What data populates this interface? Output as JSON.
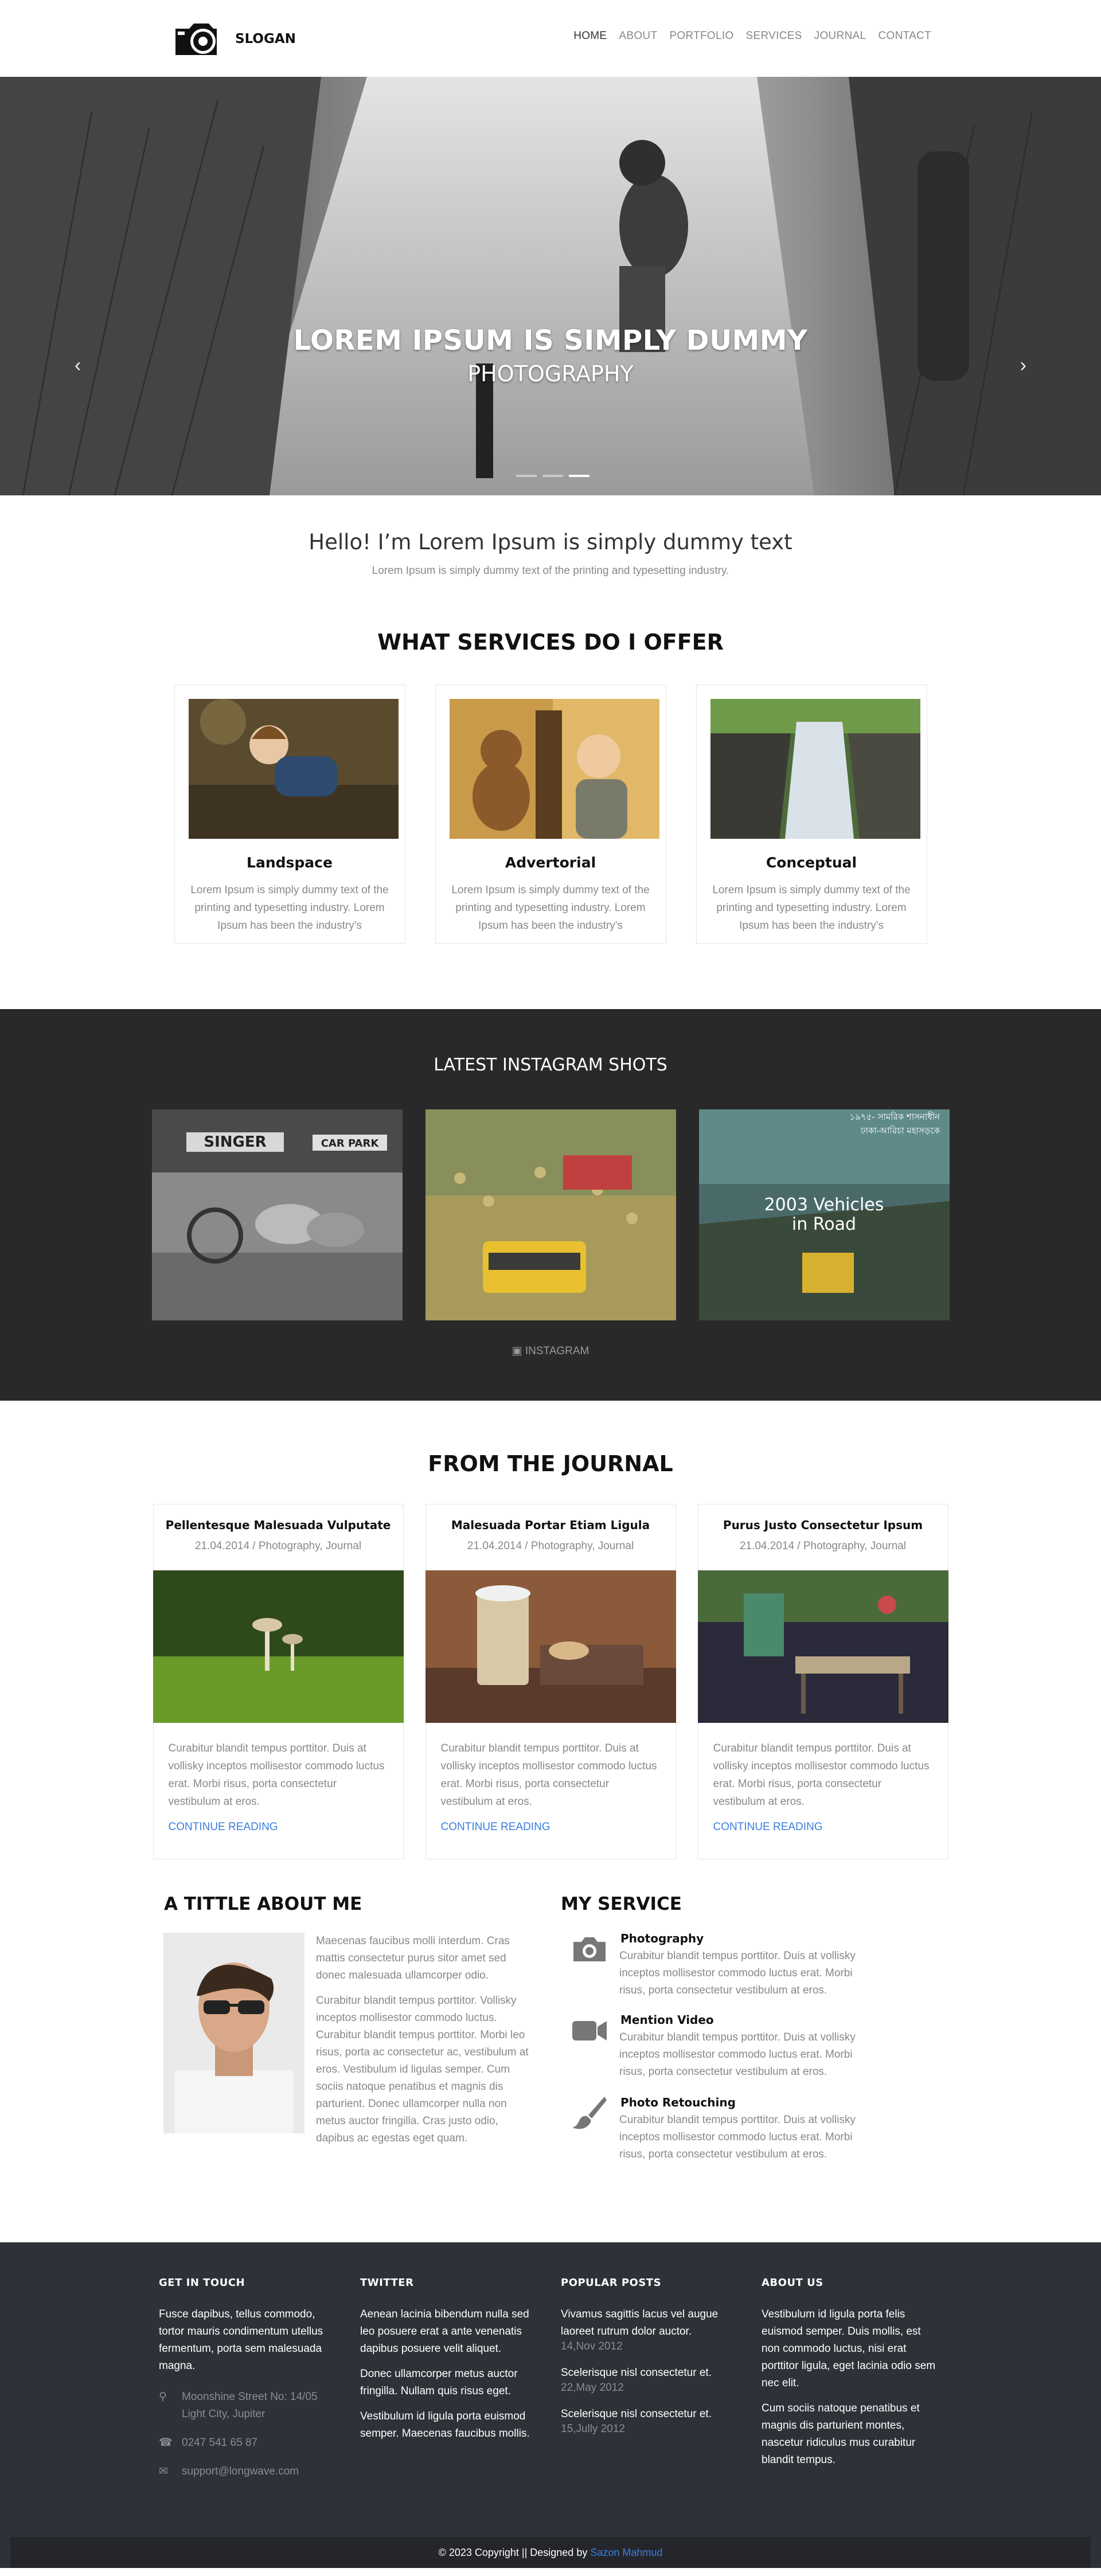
{
  "header": {
    "logo_text": "SLOGAN",
    "nav": [
      "HOME",
      "ABOUT",
      "PORTFOLIO",
      "SERVICES",
      "JOURNAL",
      "CONTACT"
    ],
    "active_nav": "HOME"
  },
  "hero": {
    "title": "LOREM IPSUM IS SIMPLY DUMMY",
    "subtitle": "PHOTOGRAPHY",
    "prev_icon": "chevron-left-icon",
    "next_icon": "chevron-right-icon",
    "slide_count": 3,
    "active_slide": 3
  },
  "intro": {
    "heading": "Hello! I’m Lorem Ipsum is simply dummy text",
    "text": "Lorem Ipsum is simply dummy text of the printing and typesetting industry."
  },
  "services": {
    "title": "WHAT SERVICES DO I OFFER",
    "items": [
      {
        "title": "Landspace",
        "text": "Lorem Ipsum is simply dummy text of the printing and typesetting industry. Lorem Ipsum has been the industry's"
      },
      {
        "title": "Advertorial",
        "text": "Lorem Ipsum is simply dummy text of the printing and typesetting industry. Lorem Ipsum has been the industry's"
      },
      {
        "title": "Conceptual",
        "text": "Lorem Ipsum is simply dummy text of the printing and typesetting industry. Lorem Ipsum has been the industry's"
      }
    ]
  },
  "instagram": {
    "title": "LATEST INSTAGRAM SHOTS",
    "photo_captions": [
      "2003 Vehicles",
      "in Road"
    ],
    "photo_text": [
      "SINGER",
      "CAR PARK",
      "১৯৭৫- সামরিক শাসনাধীন",
      "ঢাকা-আরিচা মহাসড়কে"
    ],
    "link_icon": "instagram-icon",
    "link_label": "INSTAGRAM"
  },
  "journal": {
    "title": "FROM THE JOURNAL",
    "posts": [
      {
        "title": "Pellentesque Malesuada Vulputate",
        "meta": "21.04.2014 / Photography, Journal",
        "excerpt": "Curabitur blandit tempus porttitor. Duis at vollisky inceptos mollisestor commodo luctus erat. Morbi risus, porta consectetur vestibulum at eros.",
        "link": "CONTINUE READING"
      },
      {
        "title": "Malesuada Portar Etiam Ligula",
        "meta": "21.04.2014 / Photography, Journal",
        "excerpt": "Curabitur blandit tempus porttitor. Duis at vollisky inceptos mollisestor commodo luctus erat. Morbi risus, porta consectetur vestibulum at eros.",
        "link": "CONTINUE READING"
      },
      {
        "title": "Purus Justo Consectetur Ipsum",
        "meta": "21.04.2014 / Photography, Journal",
        "excerpt": "Curabitur blandit tempus porttitor. Duis at vollisky inceptos mollisestor commodo luctus erat. Morbi risus, porta consectetur vestibulum at eros.",
        "link": "CONTINUE READING"
      }
    ]
  },
  "about": {
    "title": "A TITTLE ABOUT ME",
    "para1": "Maecenas faucibus molli interdum. Cras mattis consectetur purus sitor amet sed donec malesuada ullamcorper odio.",
    "para2": "Curabitur blandit tempus porttitor. Vollisky inceptos mollisestor commodo luctus. Curabitur blandit tempus porttitor. Morbi leo risus, porta ac consectetur ac, vestibulum at eros. Vestibulum id ligulas semper. Cum sociis natoque penatibus et magnis dis parturient. Donec ullamcorper nulla non metus auctor fringilla. Cras justo odio, dapibus ac egestas eget quam."
  },
  "my_service": {
    "title": "MY SERVICE",
    "items": [
      {
        "icon": "camera-icon",
        "title": "Photography",
        "text": "Curabitur blandit tempus porttitor. Duis at vollisky inceptos mollisestor commodo luctus erat. Morbi risus, porta consectetur vestibulum at eros."
      },
      {
        "icon": "video-camera-icon",
        "title": "Mention Video",
        "text": "Curabitur blandit tempus porttitor. Duis at vollisky inceptos mollisestor commodo luctus erat. Morbi risus, porta consectetur vestibulum at eros."
      },
      {
        "icon": "paint-brush-icon",
        "title": "Photo Retouching",
        "text": "Curabitur blandit tempus porttitor. Duis at vollisky inceptos mollisestor commodo luctus erat. Morbi risus, porta consectetur vestibulum at eros."
      }
    ]
  },
  "footer": {
    "contact": {
      "title": "GET IN TOUCH",
      "text": "Fusce dapibus, tellus commodo, tortor mauris condimentum utellus fermentum, porta sem malesuada magna.",
      "address": "Moonshine Street No: 14/05 Light City, Jupiter",
      "phone": "0247 541 65 87",
      "email": "support@longwave.com"
    },
    "twitter": {
      "title": "TWITTER",
      "tweets": [
        "Aenean lacinia bibendum nulla sed leo posuere erat a ante venenatis dapibus posuere velit aliquet.",
        "Donec ullamcorper metus auctor fringilla. Nullam quis risus eget.",
        "Vestibulum id ligula porta euismod semper. Maecenas faucibus mollis."
      ]
    },
    "popular": {
      "title": "POPULAR POSTS",
      "posts": [
        {
          "title": "Vivamus sagittis lacus vel augue laoreet rutrum dolor auctor.",
          "date": "14,Nov 2012"
        },
        {
          "title": "Scelerisque nisl consectetur et.",
          "date": "22,May 2012"
        },
        {
          "title": "Scelerisque nisl consectetur et.",
          "date": "15,Jully 2012"
        }
      ]
    },
    "about": {
      "title": "ABOUT US",
      "para1": "Vestibulum id ligula porta felis euismod semper. Duis mollis, est non commodo luctus, nisi erat porttitor ligula, eget lacinia odio sem nec elit.",
      "para2": "Cum sociis natoque penatibus et magnis dis parturient montes, nascetur ridiculus mus curabitur blandit tempus."
    },
    "copyright": "© 2023 Copyright || Designed by",
    "designer": "Sazon Mahmud"
  },
  "colors": {
    "accent": "#3b7ddd",
    "dark_band": "#292929",
    "footer": "#2f3138"
  }
}
